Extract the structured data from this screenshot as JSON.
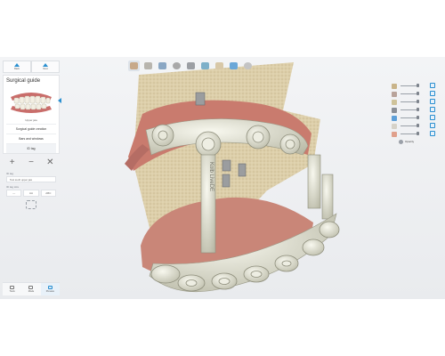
{
  "nav": {
    "back_label": "Back",
    "next_label": "Next"
  },
  "panel": {
    "title": "Surgical guide",
    "thumbnail_caption": "Upper jaw",
    "items": [
      {
        "label": "Surgical guide creation"
      },
      {
        "label": "Bars and windows"
      },
      {
        "label": "ID tag"
      }
    ],
    "tools": {
      "add": "+",
      "remove": "−",
      "close": "✕"
    },
    "id_tag": {
      "label": "ID tag",
      "value": "Test tooth upper jaw"
    },
    "id_tag_size": {
      "label": "ID tag size",
      "options": [
        "—",
        "AA",
        "ABC"
      ]
    }
  },
  "bottombar": {
    "tools_label": "Tools",
    "mode_label": "Mode",
    "preview_label": "Preview"
  },
  "toolbar": {
    "icons": [
      "bone-icon",
      "model-icon",
      "scan-icon",
      "jaw-icon",
      "implant-icon",
      "view-icon",
      "teeth-icon",
      "sleeve-icon",
      "guide-icon"
    ]
  },
  "rightpanel": {
    "opacity_label": "Opacity",
    "layers": [
      {
        "icon": "layer-scan",
        "color": "#c9b48a"
      },
      {
        "icon": "layer-jaw",
        "color": "#b9a39a"
      },
      {
        "icon": "layer-bone",
        "color": "#cfc39a"
      },
      {
        "icon": "layer-implant",
        "color": "#8b8f96"
      },
      {
        "icon": "layer-sleeve",
        "color": "#5fa0d8"
      },
      {
        "icon": "layer-guide",
        "color": "#d6d2c8"
      },
      {
        "icon": "layer-gum",
        "color": "#e0a08c"
      }
    ]
  },
  "scene": {
    "tag_text": "Kolb LiveDE"
  },
  "colors": {
    "accent": "#2a8fd0",
    "guide": "#dcdccd",
    "gum": "#c97b6e",
    "bone": "#d8c9a2"
  }
}
